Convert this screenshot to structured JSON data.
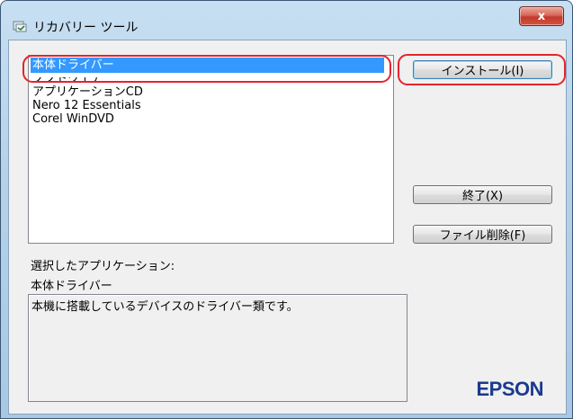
{
  "window": {
    "title": "リカバリー ツール",
    "close_glyph": "x"
  },
  "app_list": {
    "items": [
      "本体ドライバー",
      "ソフトウェア",
      "アプリケーションCD",
      "Nero 12 Essentials",
      "Corel WinDVD"
    ],
    "selected_index": 0
  },
  "buttons": {
    "install": "インストール(I)",
    "exit": "終了(X)",
    "delete_files": "ファイル削除(F)"
  },
  "selection": {
    "caption": "選択したアプリケーション:",
    "name": "本体ドライバー",
    "description": "本機に搭載しているデバイスのドライバー類です。"
  },
  "brand": {
    "logo": "EPSON",
    "logo_color": "#1a3a8e",
    "highlight_color": "#e5242c",
    "selection_color": "#3399ff"
  }
}
